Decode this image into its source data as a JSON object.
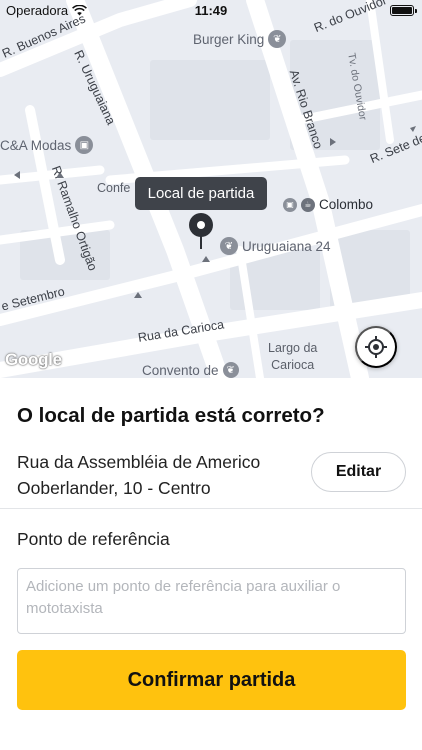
{
  "status_bar": {
    "carrier": "Operadora",
    "time": "11:49"
  },
  "map": {
    "streets": {
      "buenos_aires": "R. Buenos Aires",
      "do_ouvidor": "R. do Ouvidor",
      "uruguaiana": "R. Uruguaiana",
      "rio_branco": "Av. Rio Branco",
      "tv_do_ouvidor": "Tv. do Ouvidor",
      "sete_de_setembro_right": "R. Sete de Se",
      "ramalho_ortigao": "R. Ramalho Ortigão",
      "sete_de_setembro_left": "e Setembro",
      "carioca": "Rua da Carioca"
    },
    "places": {
      "burger_king": "Burger King",
      "ca_modas": "C&A Modas",
      "colombo": "Colombo",
      "uruguaiana_24": "Uruguaiana 24",
      "confeitaria": "Confe",
      "largo_da_carioca": "Largo da\nCarioca",
      "convento": "Convento de"
    },
    "pickup_tooltip": "Local de partida",
    "google_logo": "Google",
    "icons": {
      "restaurant": "fork-knife-icon",
      "shopping": "shopping-bag-icon",
      "cafe": "coffee-icon",
      "locate": "crosshair-icon",
      "pin": "map-pin-icon"
    }
  },
  "sheet": {
    "title": "O local de partida está correto?",
    "address": "Rua da Assembléia de Americo Ooberlander, 10 - Centro",
    "edit_label": "Editar",
    "reference_label": "Ponto de referência",
    "reference_placeholder": "Adicione um ponto de referência para auxiliar o mototaxista",
    "reference_value": "",
    "confirm_label": "Confirmar partida"
  },
  "colors": {
    "accent": "#ffc20e",
    "map_background": "#e9ecf2",
    "tooltip_background": "#3f434a"
  }
}
